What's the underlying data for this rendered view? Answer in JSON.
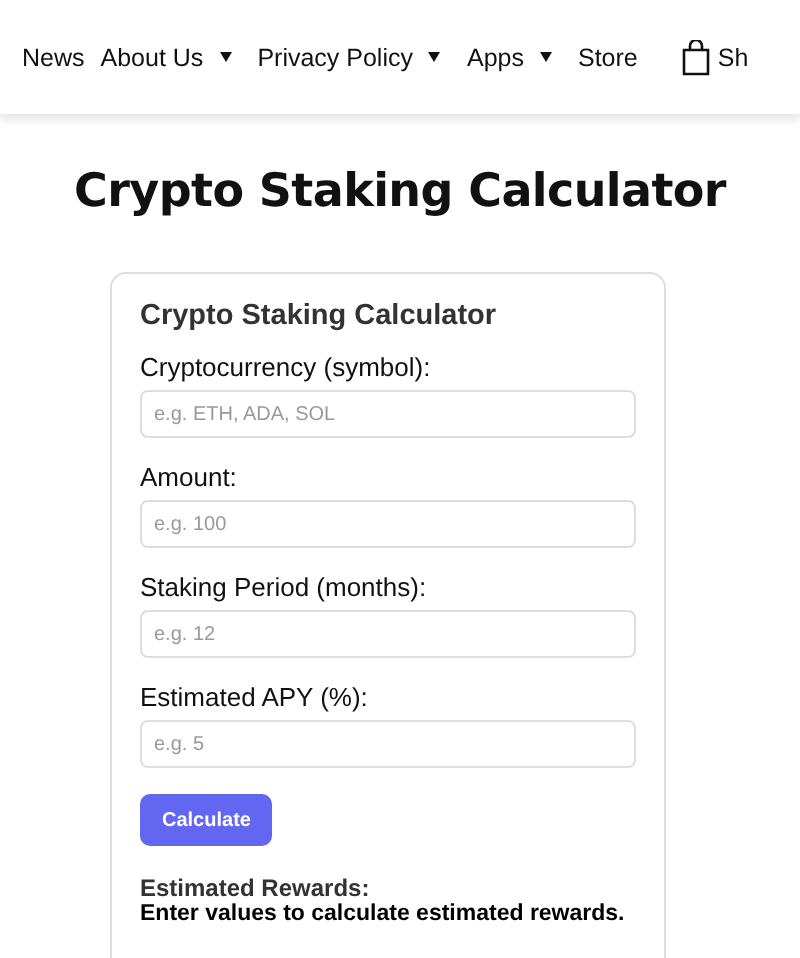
{
  "nav": {
    "items": [
      {
        "label": "News",
        "has_dropdown": false
      },
      {
        "label": "About Us",
        "has_dropdown": true
      },
      {
        "label": "Privacy Policy",
        "has_dropdown": true
      },
      {
        "label": "Apps",
        "has_dropdown": true
      },
      {
        "label": "Store",
        "has_dropdown": false
      }
    ],
    "cart_label": "Sh"
  },
  "page_title": "Crypto Staking Calculator",
  "card": {
    "title": "Crypto Staking Calculator",
    "fields": [
      {
        "label": "Cryptocurrency (symbol):",
        "placeholder": "e.g. ETH, ADA, SOL"
      },
      {
        "label": "Amount:",
        "placeholder": "e.g. 100"
      },
      {
        "label": "Staking Period (months):",
        "placeholder": "e.g. 12"
      },
      {
        "label": "Estimated APY (%):",
        "placeholder": "e.g. 5"
      }
    ],
    "button": "Calculate",
    "result_label": "Estimated Rewards:",
    "result_text": "Enter values to calculate estimated rewards."
  }
}
